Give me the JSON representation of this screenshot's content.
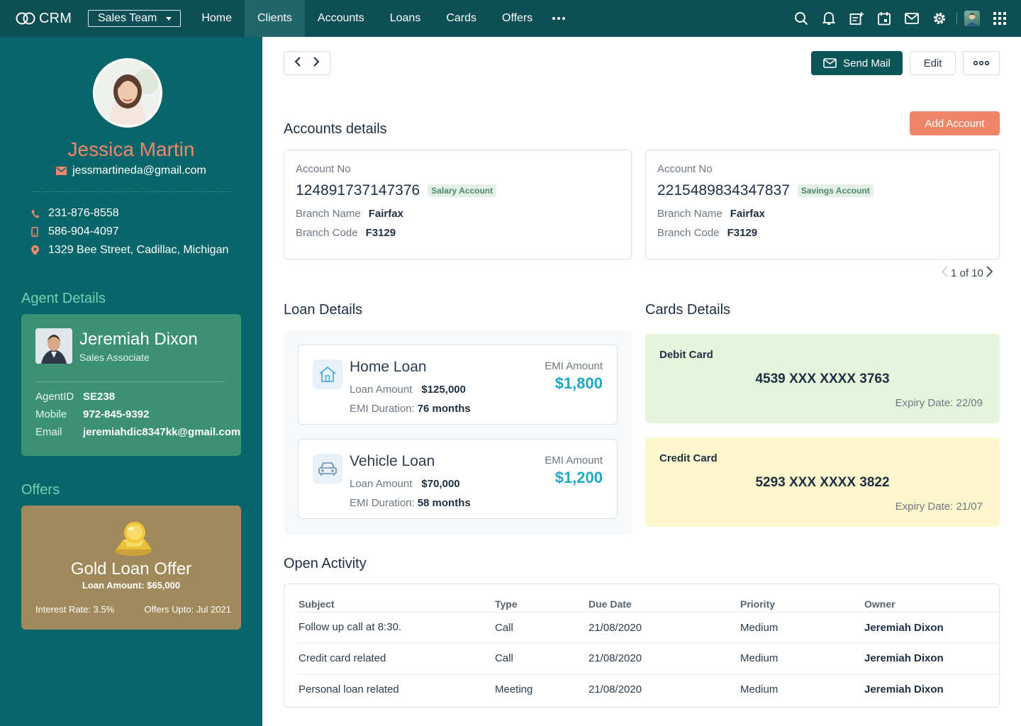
{
  "topbar": {
    "brand": "CRM",
    "team_select": "Sales Team",
    "nav": [
      "Home",
      "Clients",
      "Accounts",
      "Loans",
      "Cards",
      "Offers"
    ],
    "active_nav": "Clients",
    "icons": [
      "search-icon",
      "bell-icon",
      "notes-icon",
      "calendar-icon",
      "mail-icon",
      "gear-icon",
      "user-avatar",
      "apps-grid-icon"
    ]
  },
  "profile": {
    "name": "Jessica Martin",
    "email": "jessmartineda@gmail.com",
    "phone": "231-876-8558",
    "mobile": "586-904-4097",
    "address": "1329  Bee Street, Cadillac, Michigan"
  },
  "agent": {
    "heading": "Agent Details",
    "name": "Jeremiah Dixon",
    "role": "Sales Associate",
    "rows": [
      {
        "k": "AgentID",
        "v": "SE238"
      },
      {
        "k": "Mobile",
        "v": "972-845-9392"
      },
      {
        "k": "Email",
        "v": "jeremiahdic8347kk@gmail.com"
      }
    ]
  },
  "offers": {
    "heading": "Offers",
    "title": "Gold Loan Offer",
    "amount": "Loan Amount: $65,000",
    "rate": "Interest Rate: 3.5%",
    "upto": "Offers Upto: Jul 2021"
  },
  "toolbar": {
    "send_mail": "Send Mail",
    "edit": "Edit"
  },
  "accounts": {
    "title": "Accounts details",
    "add_button": "Add Account",
    "label_account": "Account No",
    "label_branch_name": "Branch Name",
    "label_branch_code": "Branch Code",
    "items": [
      {
        "number": "124891737147376",
        "badge": "Salary Account",
        "branch_name": "Fairfax",
        "branch_code": "F3129"
      },
      {
        "number": "2215489834347837",
        "badge": "Savings Account",
        "branch_name": "Fairfax",
        "branch_code": "F3129"
      }
    ],
    "pager": "1 of 10"
  },
  "loans": {
    "title": "Loan Details",
    "label_amount": "Loan Amount",
    "label_duration": "EMI Duration:",
    "label_emi": "EMI Amount",
    "items": [
      {
        "name": "Home Loan",
        "amount": "$125,000",
        "duration": "76 months",
        "emi": "$1,800",
        "icon": "home-icon"
      },
      {
        "name": "Vehicle Loan",
        "amount": "$70,000",
        "duration": "58 months",
        "emi": "$1,200",
        "icon": "car-icon"
      }
    ]
  },
  "cards": {
    "title": "Cards Details",
    "items": [
      {
        "type": "Debit Card",
        "number": "4539 XXX XXXX 3763",
        "expiry": "Expiry Date: 22/09",
        "color": "#e4f5dc"
      },
      {
        "type": "Credit Card",
        "number": "5293 XXX XXXX 3822",
        "expiry": "Expiry Date: 21/07",
        "color": "#fdf5cc"
      }
    ]
  },
  "activity": {
    "title": "Open Activity",
    "columns": [
      "Subject",
      "Type",
      "Due Date",
      "Priority",
      "Owner"
    ],
    "rows": [
      [
        "Follow up call at 8:30.",
        "Call",
        "21/08/2020",
        "Medium",
        "Jeremiah Dixon"
      ],
      [
        "Credit card related",
        "Call",
        "21/08/2020",
        "Medium",
        "Jeremiah Dixon"
      ],
      [
        "Personal loan related",
        "Meeting",
        "21/08/2020",
        "Medium",
        "Jeremiah Dixon"
      ]
    ]
  },
  "colors": {
    "topbar": "#0e4e55",
    "sidebar": "#086569",
    "accent_name": "#f0876a",
    "agent_card": "#3c9174",
    "offer_card": "#a0895a",
    "primary_button": "#0b5458",
    "add_button": "#f0856a",
    "emi": "#1fa8c7"
  }
}
